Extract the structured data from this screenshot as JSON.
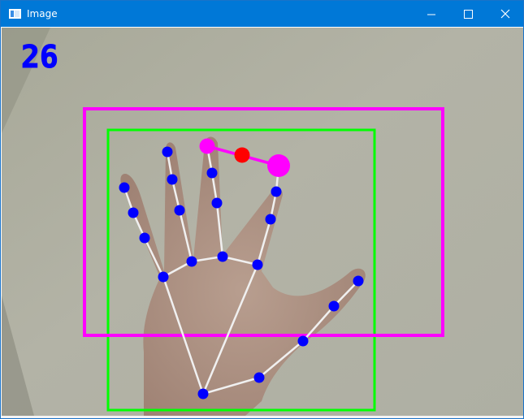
{
  "window": {
    "title": "Image",
    "minimize_icon": "minimize-icon",
    "maximize_icon": "maximize-icon",
    "close_icon": "close-icon",
    "titlebar_color": "#0078d7"
  },
  "overlay": {
    "counter_text": "26",
    "counter_color": "#0000ff",
    "landmark_color": "#0000ff",
    "connection_color": "#f0f0f0",
    "outer_box_color": "#ff00ff",
    "inner_box_color": "#00ff00",
    "gesture_line_color": "#ff00ff",
    "midpoint_color": "#ff0000"
  }
}
